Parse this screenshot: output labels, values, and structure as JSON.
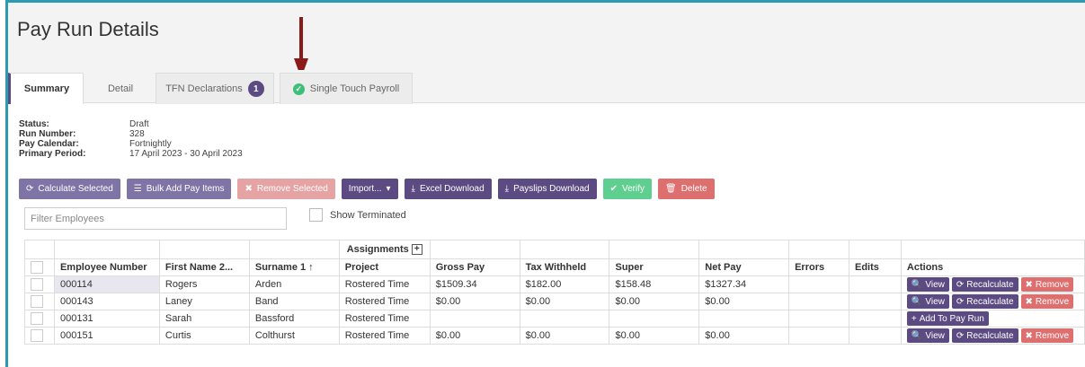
{
  "page": {
    "title": "Pay Run Details"
  },
  "tabs": [
    {
      "label": "Summary"
    },
    {
      "label": "Detail"
    },
    {
      "label": "TFN Declarations",
      "badge": "1"
    },
    {
      "label": "Single Touch Payroll",
      "icon": "check-circle-icon"
    }
  ],
  "info": {
    "status_label": "Status:",
    "status": "Draft",
    "run_number_label": "Run Number:",
    "run_number": "328",
    "pay_calendar_label": "Pay Calendar:",
    "pay_calendar": "Fortnightly",
    "primary_period_label": "Primary Period:",
    "primary_period": "17 April 2023 - 30 April 2023"
  },
  "toolbar": {
    "calculate_selected": "Calculate Selected",
    "bulk_add": "Bulk Add Pay Items",
    "remove_selected": "Remove Selected",
    "import": "Import...",
    "excel_download": "Excel Download",
    "payslips_download": "Payslips Download",
    "verify": "Verify",
    "delete": "Delete"
  },
  "filter": {
    "placeholder": "Filter Employees",
    "show_terminated": "Show Terminated"
  },
  "table": {
    "group_header": "Assignments",
    "columns": {
      "employee_number": "Employee Number",
      "first_name": "First Name 2...",
      "surname": "Surname 1 ↑",
      "project": "Project",
      "gross_pay": "Gross Pay",
      "tax_withheld": "Tax Withheld",
      "super": "Super",
      "net_pay": "Net Pay",
      "errors": "Errors",
      "edits": "Edits",
      "actions": "Actions"
    },
    "action_labels": {
      "view": "View",
      "recalculate": "Recalculate",
      "remove": "Remove",
      "add_to_pay_run": "Add To Pay Run"
    },
    "rows": [
      {
        "employee_number": "000114",
        "first_name": "Rogers",
        "surname": "Arden",
        "project": "Rostered Time",
        "gross_pay": "$1509.34",
        "tax_withheld": "$182.00",
        "super": "$158.48",
        "net_pay": "$1327.34"
      },
      {
        "employee_number": "000143",
        "first_name": "Laney",
        "surname": "Band",
        "project": "Rostered Time",
        "gross_pay": "$0.00",
        "tax_withheld": "$0.00",
        "super": "$0.00",
        "net_pay": "$0.00"
      },
      {
        "employee_number": "000131",
        "first_name": "Sarah",
        "surname": "Bassford",
        "project": "Rostered Time",
        "gross_pay": "",
        "tax_withheld": "",
        "super": "",
        "net_pay": ""
      },
      {
        "employee_number": "000151",
        "first_name": "Curtis",
        "surname": "Colthurst",
        "project": "Rostered Time",
        "gross_pay": "$0.00",
        "tax_withheld": "$0.00",
        "super": "$0.00",
        "net_pay": "$0.00"
      }
    ]
  },
  "colors": {
    "accent": "#5b4b82",
    "frame": "#2a9bb0",
    "arrow": "#8b1a1a",
    "success": "#3cbf78",
    "danger": "#dd6f6f"
  }
}
